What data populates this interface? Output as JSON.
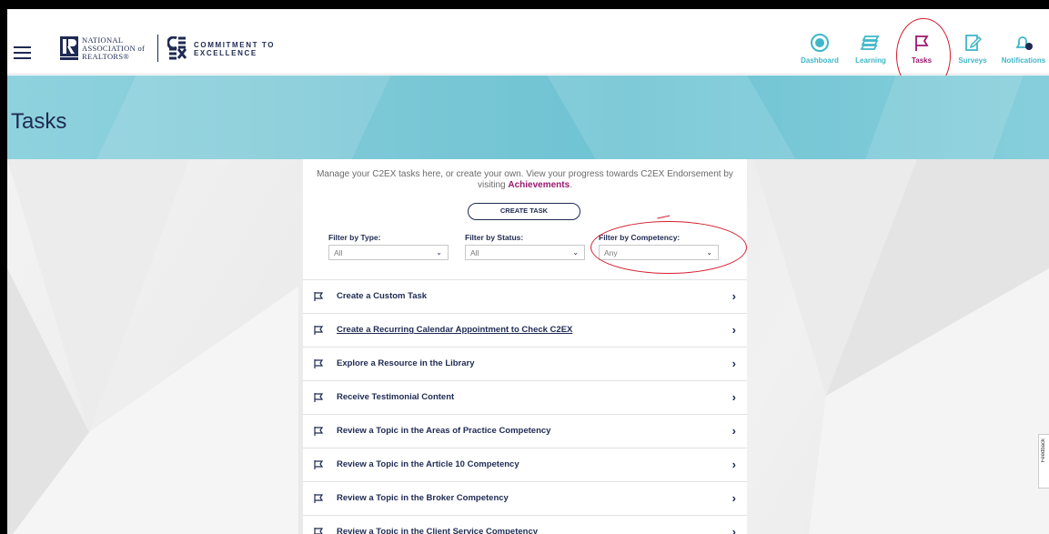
{
  "header": {
    "nar_logo_lines": [
      "NATIONAL",
      "ASSOCIATION of",
      "REALTORS®"
    ],
    "c2ex_logo_lines": [
      "COMMITMENT TO",
      "EXCELLENCE"
    ],
    "nav": [
      {
        "label": "Dashboard",
        "icon": "dashboard-icon"
      },
      {
        "label": "Learning",
        "icon": "learning-icon"
      },
      {
        "label": "Tasks",
        "icon": "flag-icon",
        "active": true
      },
      {
        "label": "Surveys",
        "icon": "survey-icon"
      },
      {
        "label": "Notifications",
        "icon": "bell-icon"
      }
    ]
  },
  "banner": {
    "title": "Tasks"
  },
  "intro": {
    "text": "Manage your C2EX tasks here, or create your own. View your progress towards C2EX Endorsement by visiting ",
    "link": "Achievements",
    "end": "."
  },
  "create_button": "CREATE TASK",
  "filters": {
    "type": {
      "label": "Filter by Type:",
      "value": "All"
    },
    "status": {
      "label": "Filter by Status:",
      "value": "All"
    },
    "competency": {
      "label": "Filter by Competency:",
      "value": "Any"
    }
  },
  "tasks": [
    "Create a Custom Task",
    "Create a Recurring Calendar Appointment to Check C2EX",
    "Explore a Resource in the Library",
    "Receive Testimonial Content",
    "Review a Topic in the Areas of Practice Competency",
    "Review a Topic in the Article 10 Competency",
    "Review a Topic in the Broker Competency",
    "Review a Topic in the Client Service Competency"
  ],
  "feedback_label": "Feedback",
  "colors": {
    "navy": "#1e2a52",
    "teal": "#3fb7c9",
    "magenta": "#9a1a6e",
    "annotation": "#d41e2e"
  }
}
